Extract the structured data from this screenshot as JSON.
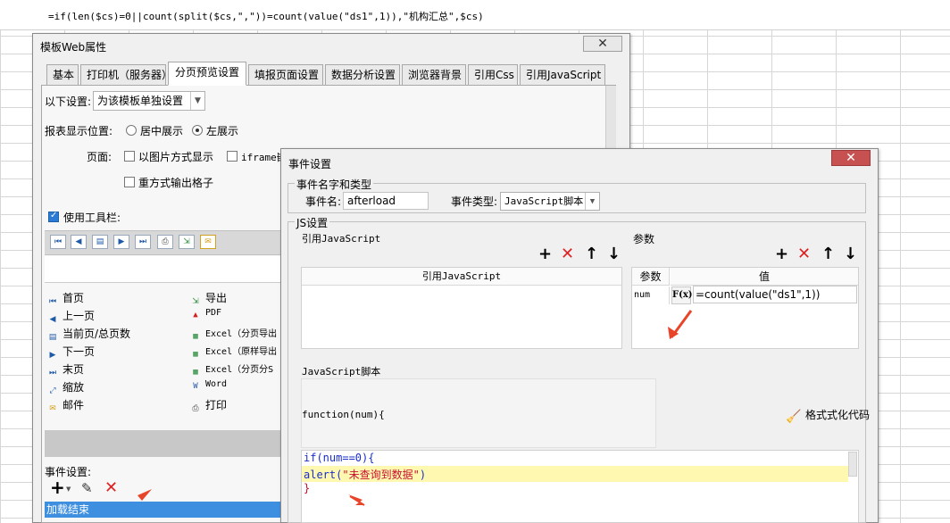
{
  "formula": "=if(len($cs)=0||count(split($cs,\",\"))=count(value(\"ds1\",1)),\"机构汇总\",$cs)",
  "web_window": {
    "title": "模板Web属性",
    "close": "✕",
    "tabs": [
      "基本",
      "打印机（服务器）",
      "分页预览设置",
      "填报页面设置",
      "数据分析设置",
      "浏览器背景",
      "引用Css",
      "引用JavaScript"
    ],
    "settings_label": "以下设置:",
    "settings_value": "为该模板单独设置",
    "position_label": "报表显示位置:",
    "position_options": [
      "居中展示",
      "左展示"
    ],
    "page_label": "页面:",
    "page_opt_image": "以图片方式显示",
    "page_opt_iframe": "iframe嵌",
    "repeat_label": "重方式输出格子",
    "use_toolbar": "使用工具栏:",
    "items_left": [
      "首页",
      "上一页",
      "当前页/总页数",
      "下一页",
      "末页",
      "缩放",
      "邮件"
    ],
    "items_right": [
      "导出",
      "PDF",
      "Excel（分页导出",
      "Excel（原样导出",
      "Excel（分页分S",
      "Word",
      "打印"
    ],
    "event_label": "事件设置:",
    "event_selected": "加载结束"
  },
  "event_dialog": {
    "title": "事件设置",
    "close": "✕",
    "group_name_type": "事件名字和类型",
    "event_name_label": "事件名:",
    "event_name_value": "afterload",
    "event_type_label": "事件类型:",
    "event_type_value": "JavaScript脚本",
    "js_group": "JS设置",
    "ref_js_title": "引用JavaScript",
    "ref_js_column": "引用JavaScript",
    "params_title": "参数",
    "params_col_param": "参数",
    "params_col_value": "值",
    "param_name": "num",
    "param_fx": "F(x)",
    "param_value": "=count(value(\"ds1\",1))",
    "script_title": "JavaScript脚本",
    "function_sig": "function(num){",
    "format_code": "格式式化代码",
    "code_line1": "if(num==0){",
    "code_line2_prefix": "alert(",
    "code_line2_string": "\"未查询到数据\"",
    "code_line2_suffix": ")",
    "code_line3": "}"
  },
  "colors": {
    "accent": "#3f8fe0",
    "delete": "#e02020",
    "arrow": "#e8442a",
    "highlight": "#fff8b0",
    "keyword": "#1a2ecc",
    "string": "#c8102e"
  }
}
